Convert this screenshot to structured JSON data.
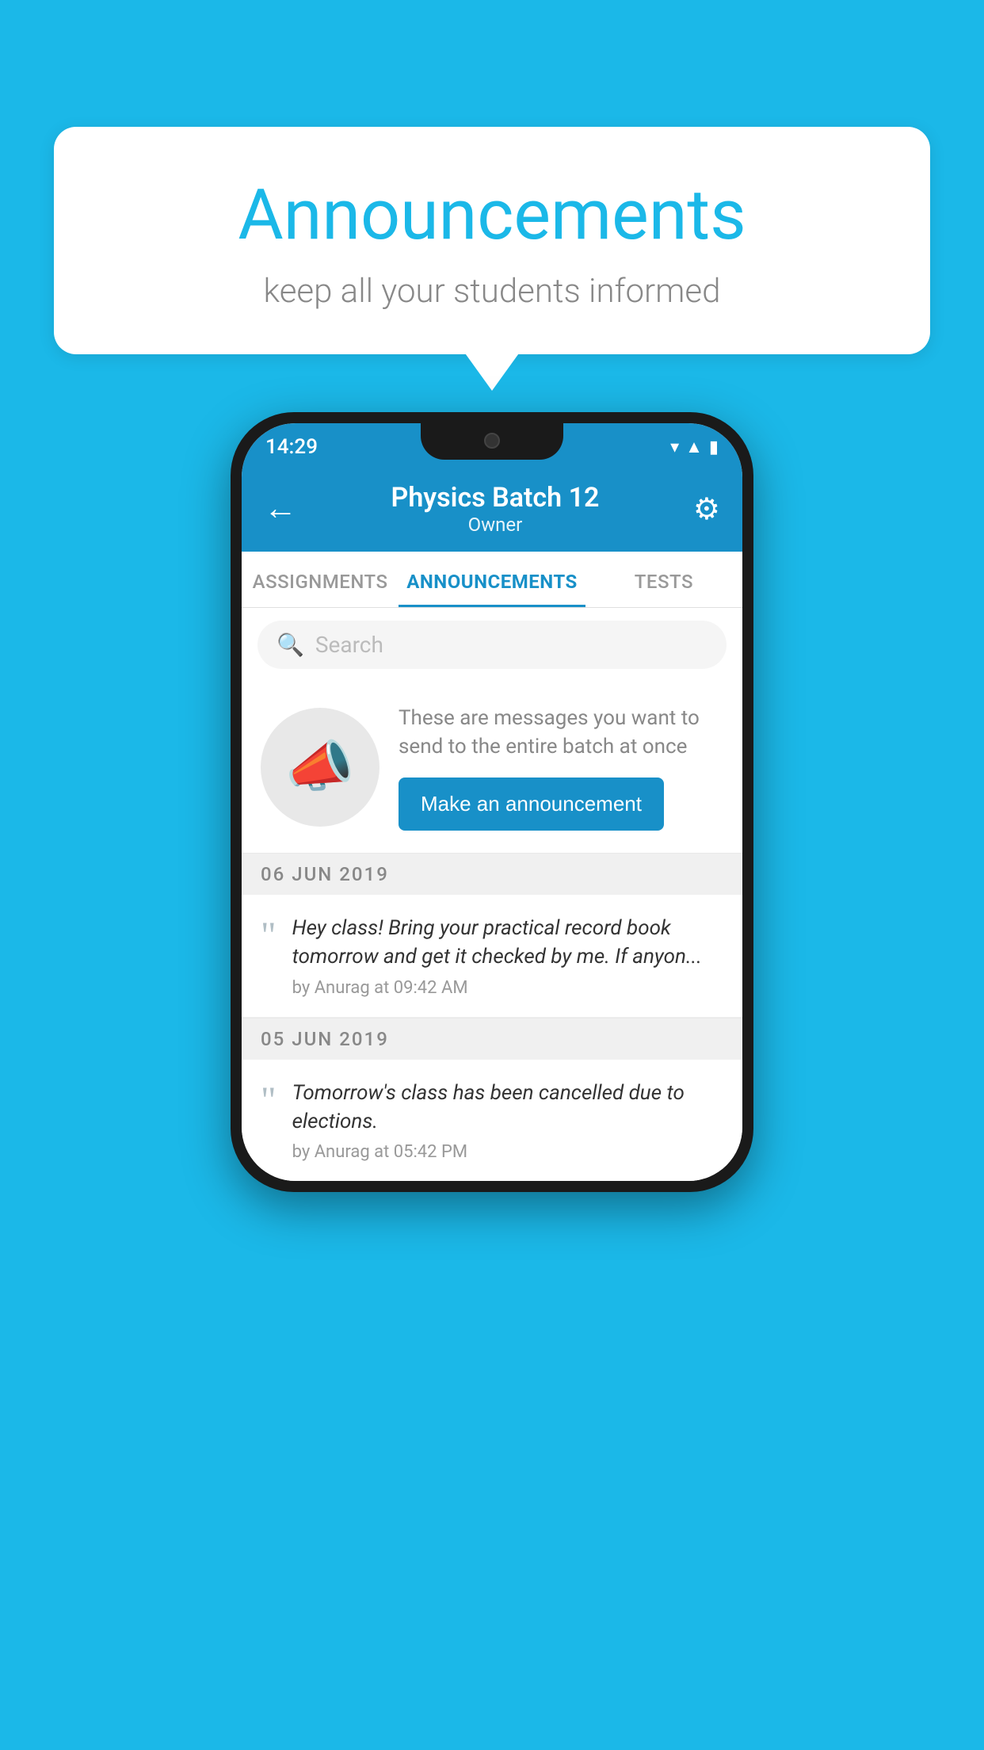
{
  "background_color": "#1bb8e8",
  "bubble": {
    "title": "Announcements",
    "subtitle": "keep all your students informed"
  },
  "phone": {
    "status_bar": {
      "time": "14:29"
    },
    "header": {
      "title": "Physics Batch 12",
      "subtitle": "Owner",
      "back_label": "←",
      "gear_label": "⚙"
    },
    "tabs": [
      {
        "label": "ASSIGNMENTS",
        "active": false
      },
      {
        "label": "ANNOUNCEMENTS",
        "active": true
      },
      {
        "label": "TESTS",
        "active": false
      }
    ],
    "search": {
      "placeholder": "Search"
    },
    "announcement_prompt": {
      "description": "These are messages you want to send to the entire batch at once",
      "button_label": "Make an announcement"
    },
    "announcements": [
      {
        "date": "06  JUN  2019",
        "message": "Hey class! Bring your practical record book tomorrow and get it checked by me. If anyon...",
        "meta": "by Anurag at 09:42 AM"
      },
      {
        "date": "05  JUN  2019",
        "message": "Tomorrow's class has been cancelled due to elections.",
        "meta": "by Anurag at 05:42 PM"
      }
    ]
  }
}
